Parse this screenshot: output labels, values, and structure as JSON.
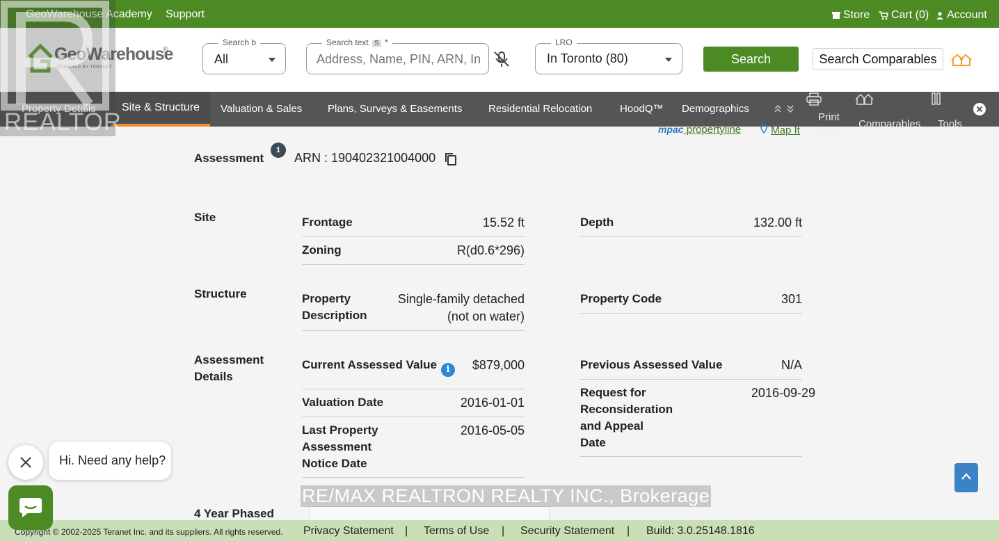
{
  "topbar": {
    "academy": "GeoWarehouse Academy",
    "support": "Support",
    "store": "Store",
    "cart": "Cart (0)",
    "account": "Account"
  },
  "logo": {
    "brand": "GeoWarehouse",
    "reg": "®",
    "tagline": "POWERED BY TERANET"
  },
  "search_by": {
    "label": "Search b",
    "value": "All"
  },
  "search_text": {
    "label": "Search text",
    "shortcut": "S",
    "required": "*",
    "placeholder": "Address, Name, PIN, ARN, Instrument"
  },
  "lro": {
    "label": "LRO",
    "value": "In Toronto (80)"
  },
  "buttons": {
    "search": "Search",
    "search_comparables": "Search Comparables"
  },
  "nav": {
    "tabs": [
      "Property Details",
      "Site & Structure",
      "Valuation & Sales",
      "Plans, Surveys & Easements",
      "Residential Relocation",
      "HoodQ™",
      "Demographics"
    ],
    "active_tab": "Site & Structure",
    "tools": {
      "print": "Print PDF",
      "comparables": "Comparables",
      "tools": "Tools"
    }
  },
  "links": {
    "mpac": "mpac",
    "propertyline": " propertyline",
    "map_it": "Map It"
  },
  "assessment": {
    "heading": "Assessment",
    "badge": "1",
    "arn": "ARN : 190402321004000"
  },
  "site": {
    "heading": "Site",
    "frontage_label": "Frontage",
    "frontage": "15.52 ft",
    "depth_label": "Depth",
    "depth": "132.00 ft",
    "zoning_label": "Zoning",
    "zoning": "R(d0.6*296)"
  },
  "structure": {
    "heading": "Structure",
    "desc_label_1": "Property",
    "desc_label_2": "Description",
    "desc_1": "Single-family detached",
    "desc_2": "(not on water)",
    "code_label": "Property Code",
    "code": "301"
  },
  "details": {
    "heading_1": "Assessment",
    "heading_2": "Details",
    "current_label": "Current Assessed Value",
    "current": "$879,000",
    "previous_label": "Previous Assessed Value",
    "previous": "N/A",
    "valuation_label": "Valuation Date",
    "valuation": "2016-01-01",
    "recon_label_1": "Request for",
    "recon_label_2": "Reconsideration",
    "recon_label_3": "and Appeal",
    "recon_label_4": "Date",
    "recon": "2016-09-29",
    "notice_label_1": "Last Property",
    "notice_label_2": "Assessment",
    "notice_label_3": "Notice Date",
    "notice": "2016-05-05"
  },
  "phased": {
    "heading": "4 Year Phased"
  },
  "footer": {
    "copyright": "Copyright © 2002-2025 Teranet Inc. and its suppliers. All rights reserved.",
    "privacy": "Privacy Statement",
    "terms": "Terms of Use",
    "security": "Security Statement",
    "sep": "|",
    "build": "Build: 3.0.25148.1816"
  },
  "overlay": {
    "realtor": "REALTOR",
    "watermark": "RE/MAX REALTRON REALTY INC., Brokerage",
    "chat_message": "Hi. Need any help?"
  },
  "colors": {
    "brand_green": "#4c8a23",
    "nav_gray": "#555555",
    "active_tab_accent": "#f08c2a",
    "footer_green": "#c9e0b6"
  }
}
